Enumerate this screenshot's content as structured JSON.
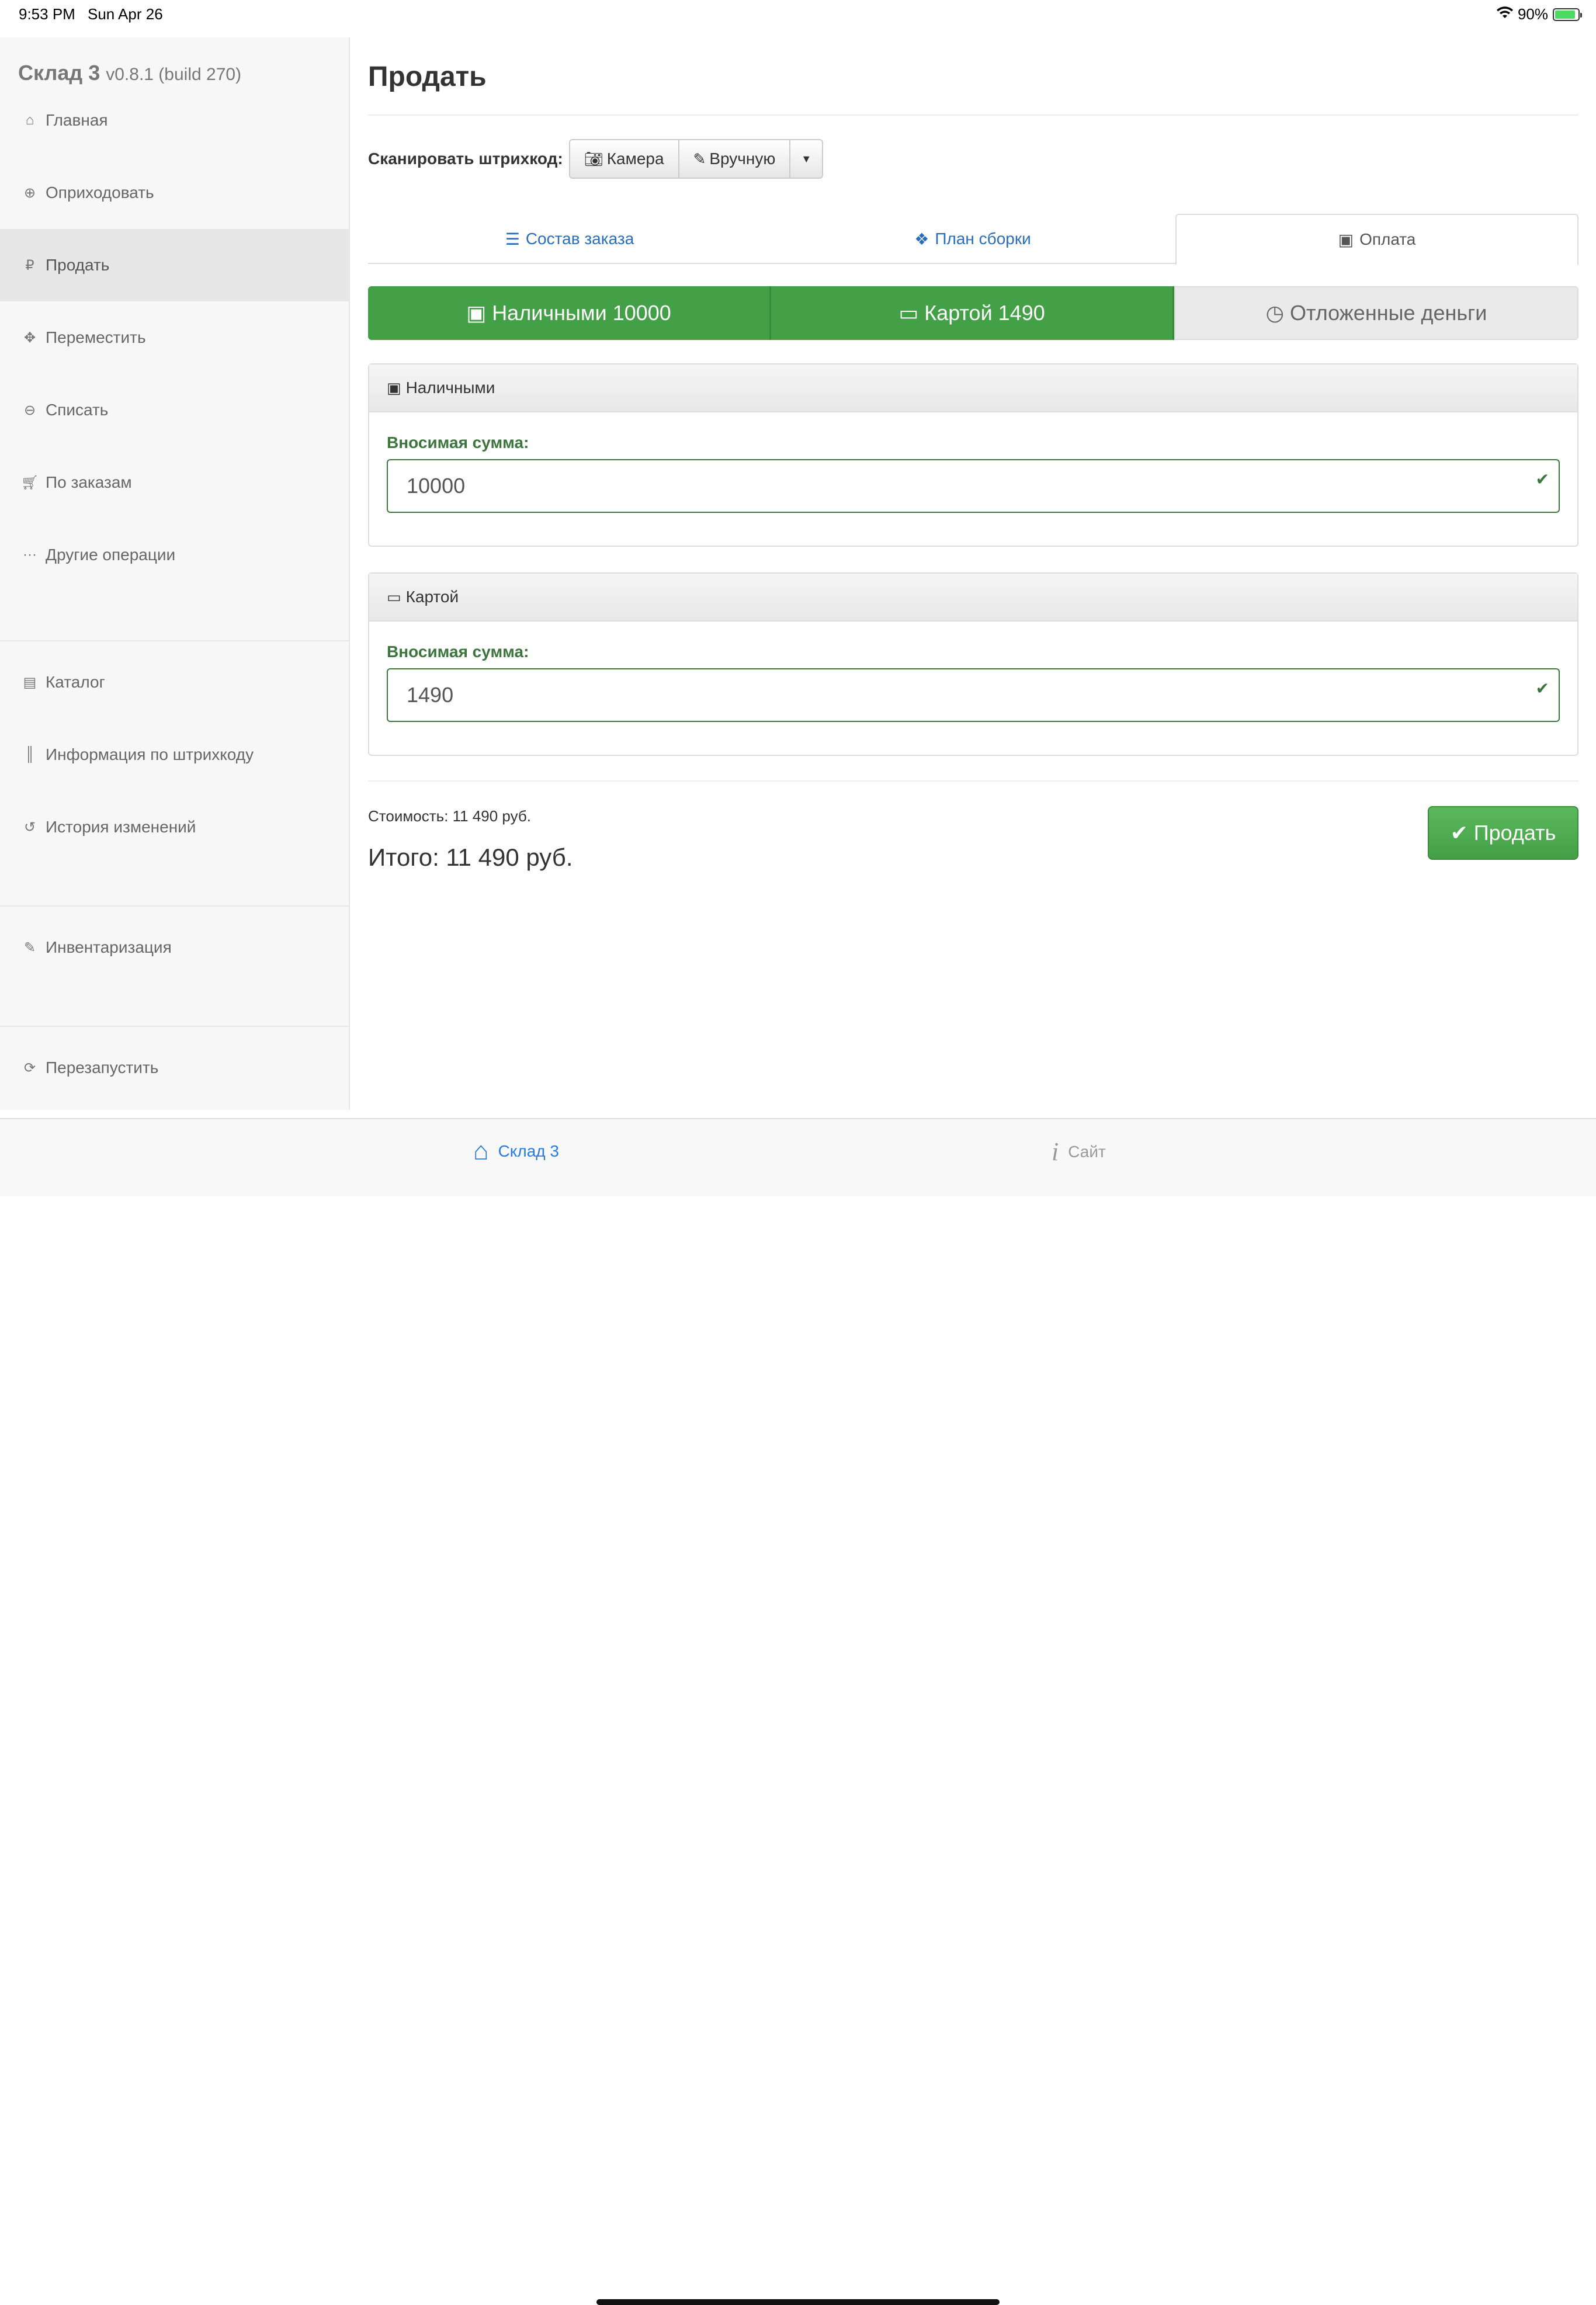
{
  "status": {
    "time": "9:53 PM",
    "date": "Sun Apr 26",
    "battery": "90%",
    "battery_level": 0.9
  },
  "app": {
    "name": "Склад 3",
    "version": "v0.8.1 (build 270)"
  },
  "sidebar": {
    "items": [
      {
        "label": "Главная",
        "icon": "home-icon"
      },
      {
        "label": "Оприходовать",
        "icon": "plus-circle-icon"
      },
      {
        "label": "Продать",
        "icon": "ruble-icon"
      },
      {
        "label": "Переместить",
        "icon": "move-icon"
      },
      {
        "label": "Списать",
        "icon": "minus-circle-icon"
      },
      {
        "label": "По заказам",
        "icon": "cart-icon"
      },
      {
        "label": "Другие операции",
        "icon": "ellipsis-icon"
      },
      {
        "label": "Каталог",
        "icon": "archive-icon"
      },
      {
        "label": "Информация по штрихкоду",
        "icon": "barcode-icon"
      },
      {
        "label": "История изменений",
        "icon": "history-icon"
      },
      {
        "label": "Инвентаризация",
        "icon": "edit-icon"
      },
      {
        "label": "Перезапустить",
        "icon": "refresh-icon"
      }
    ]
  },
  "page": {
    "title": "Продать"
  },
  "scan": {
    "label": "Сканировать штрихкод:",
    "camera": "Камера",
    "manual": "Вручную"
  },
  "tabs": [
    {
      "label": "Состав заказа",
      "icon": "list-icon"
    },
    {
      "label": "План сборки",
      "icon": "cubes-icon"
    },
    {
      "label": "Оплата",
      "icon": "money-icon"
    }
  ],
  "payment_methods": [
    {
      "label": "Наличными 10000",
      "icon": "money-icon"
    },
    {
      "label": "Картой 1490",
      "icon": "credit-card-icon"
    },
    {
      "label": "Отложенные деньги",
      "icon": "clock-icon"
    }
  ],
  "panels": [
    {
      "title": "Наличными",
      "field_label": "Вносимая сумма:",
      "value": "10000"
    },
    {
      "title": "Картой",
      "field_label": "Вносимая сумма:",
      "value": "1490"
    }
  ],
  "summary": {
    "cost": "Стоимость: 11 490 руб.",
    "total": "Итого: 11 490 руб.",
    "sell_button": "Продать"
  },
  "tabbar": {
    "home": "Склад 3",
    "site": "Сайт"
  },
  "colors": {
    "accent": "#2a6ebb",
    "success": "#44a046",
    "success_text": "#3c763d"
  }
}
